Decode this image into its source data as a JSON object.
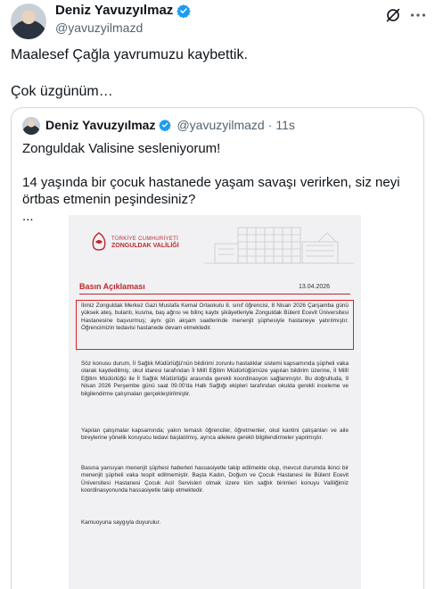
{
  "tweet": {
    "author_name": "Deniz Yavuzyılmaz",
    "author_handle": "@yavuzyilmazd",
    "lines": [
      "Maalesef Çağla yavrumuzu kaybettik.",
      "Çok üzgünüm…"
    ]
  },
  "icons": {
    "verified": "verified-badge-icon",
    "slash": "grok-slash-icon",
    "more": "more-options-icon"
  },
  "quote": {
    "author_name": "Deniz Yavuzyılmaz",
    "author_handle": "@yavuzyilmazd",
    "separator": "·",
    "time": "11s",
    "line1": "Zonguldak Valisine sesleniyorum!",
    "line2": "14 yaşında bir çocuk hastanede yaşam savaşı verirken, siz neyi örtbas etmenin peşindesiniz?",
    "line3": "..."
  },
  "document": {
    "org_line1": "TÜRKİYE CUMHURİYETİ",
    "org_line2": "ZONGULDAK VALİLİĞİ",
    "title": "Basın Açıklaması",
    "date": "13.04.2026",
    "p1": "İlimiz Zonguldak Merkez Gazi Mustafa Kemal Ortaokulu 8. sınıf öğrencisi, 8 Nisan 2026 Çarşamba günü yüksek ateş, bulantı, kusma, baş ağrısı ve bilinç kaybı şikâyetleriyle Zonguldak Bülent Ecevit Üniversitesi Hastanesine başvurmuş; aynı gün akşam saatlerinde menenjit şüphesiyle hastaneye yatırılmıştır. Öğrencimizin tedavisi hastanede devam etmektedir.",
    "p2": "Söz konusu durum, İl Sağlık Müdürlüğü'nün bildirimi zorunlu hastalıklar sistemi kapsamında şüpheli vaka olarak kaydedilmiş; okul idaresi tarafından İl Millî Eğitim Müdürlüğümüze yapılan bildirim üzerine, İl Millî Eğitim Müdürlüğü ile İl Sağlık Müdürlüğü arasında gerekli koordinasyon sağlanmıştır. Bu doğrultuda, 9 Nisan 2026 Perşembe günü saat 09.00'da Halk Sağlığı ekipleri tarafından okulda gerekli inceleme ve bilgilendirme çalışmaları gerçekleştirilmiştir.",
    "p3": "Yapılan çalışmalar kapsamında; yakın temaslı öğrenciler, öğretmenler, okul kantini çalışanları ve aile bireylerine yönelik koruyucu tedavi başlatılmış, ayrıca ailelere gerekli bilgilendirmeler yapılmıştır.",
    "p4": "Basına yansıyan menenjit şüphesi haberleri hassasiyetle takip edilmekte olup, mevcut durumda ikinci bir menenjit şüpheli vaka tespit edilmemiştir. Başta Kadın, Doğum ve Çocuk Hastanesi ile Bülent Ecevit Üniversitesi Hastanesi Çocuk Acil Servisleri olmak üzere tüm sağlık birimleri konuyu Valiliğimiz koordinasyonunda hassasiyetle takip etmektedir.",
    "p5": "Kamuoyuna saygıyla duyurulur."
  },
  "colors": {
    "brand_red": "#c0272d",
    "highlight_box": "#e02020",
    "verified_blue": "#1d9bf0",
    "secondary_text": "#536471"
  }
}
